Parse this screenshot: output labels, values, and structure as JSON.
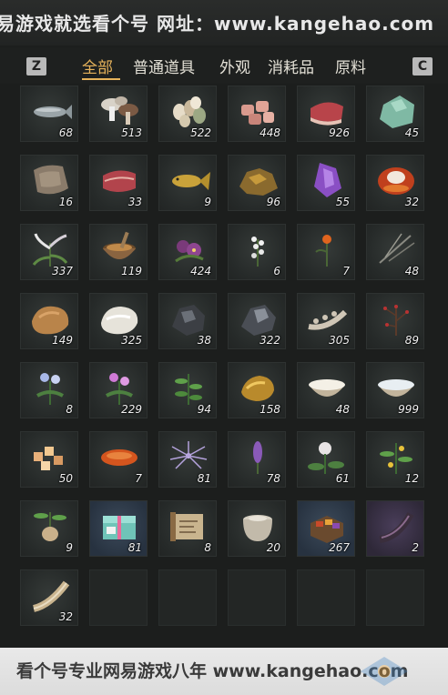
{
  "watermark_top": "易游戏就选看个号  网址：www.kangehao.com",
  "watermark_bottom": "看个号专业网易游戏八年 www.kangehao.com",
  "keys": {
    "left": "Z",
    "right": "C"
  },
  "tabs": [
    {
      "label": "全部",
      "active": true
    },
    {
      "label": "普通道具",
      "active": false
    },
    {
      "label": "外观",
      "active": false
    },
    {
      "label": "消耗品",
      "active": false
    },
    {
      "label": "原料",
      "active": false
    }
  ],
  "colors": {
    "accent": "#e7b35b",
    "tab_text": "#e3e0d6",
    "bg": "#1c1e1d"
  },
  "items": [
    {
      "icon": "fish-icon",
      "qty": "68"
    },
    {
      "icon": "mushroom-icon",
      "qty": "513"
    },
    {
      "icon": "eggs-icon",
      "qty": "522"
    },
    {
      "icon": "meat-chunks-icon",
      "qty": "448"
    },
    {
      "icon": "steak-icon",
      "qty": "926"
    },
    {
      "icon": "jade-stone-icon",
      "qty": "45"
    },
    {
      "icon": "hide-leather-icon",
      "qty": "16"
    },
    {
      "icon": "raw-meat-icon",
      "qty": "33"
    },
    {
      "icon": "golden-fish-icon",
      "qty": "9"
    },
    {
      "icon": "ore-icon",
      "qty": "96"
    },
    {
      "icon": "amethyst-icon",
      "qty": "55"
    },
    {
      "icon": "agate-icon",
      "qty": "32"
    },
    {
      "icon": "white-herb-icon",
      "qty": "337"
    },
    {
      "icon": "mortar-spice-icon",
      "qty": "119"
    },
    {
      "icon": "purple-flower-icon",
      "qty": "424"
    },
    {
      "icon": "white-flower-icon",
      "qty": "6"
    },
    {
      "icon": "orange-flower-icon",
      "qty": "7"
    },
    {
      "icon": "dry-grass-icon",
      "qty": "48"
    },
    {
      "icon": "tan-fur-icon",
      "qty": "149"
    },
    {
      "icon": "white-fur-icon",
      "qty": "325"
    },
    {
      "icon": "black-ore-icon",
      "qty": "38"
    },
    {
      "icon": "iron-ore-icon",
      "qty": "322"
    },
    {
      "icon": "bone-icon",
      "qty": "305"
    },
    {
      "icon": "red-berry-bush-icon",
      "qty": "89"
    },
    {
      "icon": "blue-flower-icon",
      "qty": "8"
    },
    {
      "icon": "pink-flower-icon",
      "qty": "229"
    },
    {
      "icon": "green-herb-icon",
      "qty": "94"
    },
    {
      "icon": "gold-nugget-icon",
      "qty": "158"
    },
    {
      "icon": "milk-bowl-icon",
      "qty": "48"
    },
    {
      "icon": "water-bowl-icon",
      "qty": "999"
    },
    {
      "icon": "rock-candy-icon",
      "qty": "50"
    },
    {
      "icon": "orange-leaf-icon",
      "qty": "7"
    },
    {
      "icon": "purple-spider-flower-icon",
      "qty": "81"
    },
    {
      "icon": "lavender-icon",
      "qty": "78"
    },
    {
      "icon": "white-bloom-icon",
      "qty": "61"
    },
    {
      "icon": "yellow-berry-icon",
      "qty": "12"
    },
    {
      "icon": "ginseng-icon",
      "qty": "9"
    },
    {
      "icon": "gift-box-icon",
      "qty": "81"
    },
    {
      "icon": "scroll-icon",
      "qty": "8"
    },
    {
      "icon": "jar-icon",
      "qty": "20"
    },
    {
      "icon": "food-box-icon",
      "qty": "267"
    },
    {
      "icon": "dark-horn-icon",
      "qty": "2"
    },
    {
      "icon": "horn-icon",
      "qty": "32"
    }
  ]
}
